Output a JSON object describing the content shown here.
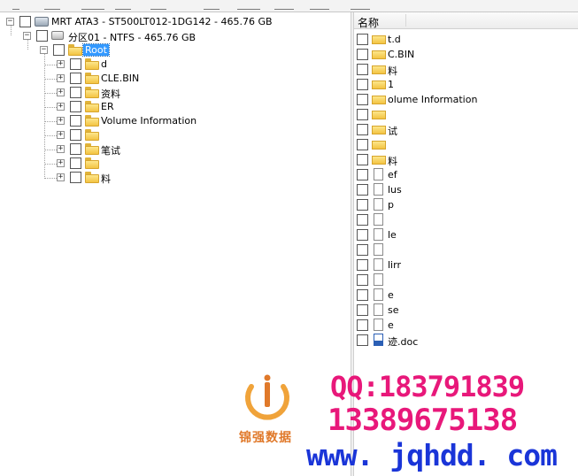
{
  "tree": {
    "disk_label": "MRT ATA3 - ST500LT012-1DG142 - 465.76 GB",
    "partition_label": "分区01 - NTFS - 465.76 GB",
    "root_label": "Root",
    "folders": [
      {
        "label": "d"
      },
      {
        "label": "CLE.BIN"
      },
      {
        "label": "资料"
      },
      {
        "label": "ER"
      },
      {
        "label": "Volume Information"
      },
      {
        "label": ""
      },
      {
        "label": "笔试"
      },
      {
        "label": ""
      },
      {
        "label": "料"
      }
    ]
  },
  "list": {
    "column_name": "名称",
    "rows": [
      {
        "label": "t.d",
        "icon": "folder"
      },
      {
        "label": "C.BIN",
        "icon": "folder"
      },
      {
        "label": "料",
        "icon": "folder"
      },
      {
        "label": "1",
        "icon": "folder"
      },
      {
        "label": "olume Information",
        "icon": "folder"
      },
      {
        "label": "",
        "icon": "folder"
      },
      {
        "label": "试",
        "icon": "folder"
      },
      {
        "label": "",
        "icon": "folder"
      },
      {
        "label": "料",
        "icon": "folder"
      },
      {
        "label": "ef",
        "icon": "file"
      },
      {
        "label": "lus",
        "icon": "file"
      },
      {
        "label": "p",
        "icon": "file"
      },
      {
        "label": "",
        "icon": "file"
      },
      {
        "label": "le",
        "icon": "file"
      },
      {
        "label": "",
        "icon": "file"
      },
      {
        "label": "lirr",
        "icon": "file"
      },
      {
        "label": "",
        "icon": "file"
      },
      {
        "label": "e",
        "icon": "file"
      },
      {
        "label": "se",
        "icon": "file"
      },
      {
        "label": "e",
        "icon": "file"
      },
      {
        "label": "迹.doc",
        "icon": "doc"
      }
    ]
  },
  "watermark": {
    "brand": "锦强数据",
    "qq": "QQ:183791839",
    "phone": "13389675138",
    "site": "www. jqhdd. com"
  },
  "colors": {
    "selection": "#3399ff",
    "watermark_pink": "#e8187a",
    "watermark_blue": "#1a35d8",
    "logo_orange": "#e0792a"
  }
}
